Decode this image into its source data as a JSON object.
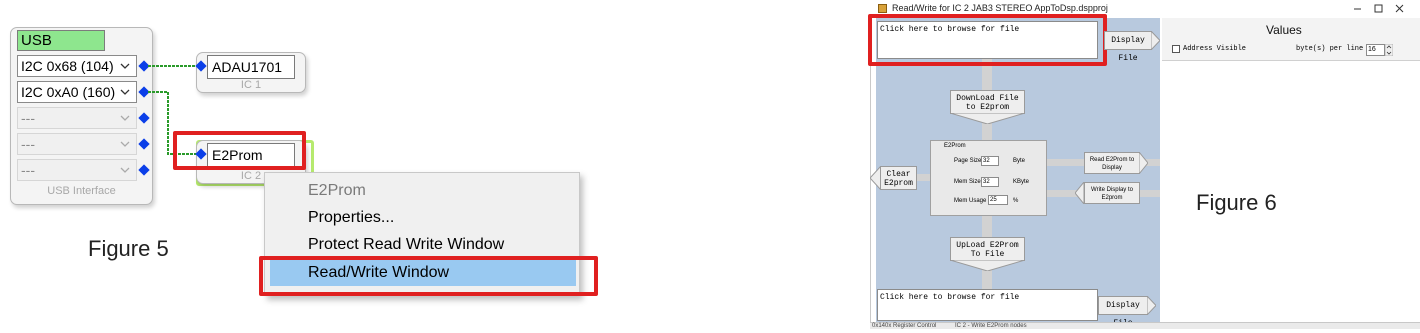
{
  "figure5": {
    "caption": "Figure 5",
    "usb_interface": {
      "title": "USB",
      "footer": "USB Interface",
      "ports": [
        "I2C 0x68 (104)",
        "I2C 0xA0 (160)",
        "---",
        "---",
        "---"
      ]
    },
    "ic1": {
      "field": "ADAU1701",
      "footer": "IC 1"
    },
    "ic2": {
      "field": "E2Prom",
      "footer": "IC 2"
    },
    "context_menu": {
      "header": "E2Prom",
      "items": [
        "Properties...",
        "Protect Read Write Window",
        "Read/Write Window"
      ],
      "selected_index": 2
    },
    "colors": {
      "highlight_border": "#e02020",
      "wire": "#2a9a2a",
      "port_marker": "#0b3fe8",
      "usb_title_fill": "#8ee68e",
      "menu_selection": "#99c9f1"
    }
  },
  "figure6": {
    "caption": "Figure 6",
    "window": {
      "title": "Read/Write for IC 2 JAB3 STEREO AppToDsp.dspproj",
      "controls": [
        "minimize-icon",
        "maximize-icon",
        "close-icon"
      ]
    },
    "top_browse_placeholder": "Click here to browse for file",
    "top_display_button": "Display File",
    "download_button": "DownLoad File to E2prom",
    "clear_button": "Clear E2prom",
    "e2prom_group": {
      "title": "E2Prom",
      "page_size_label": "Page Size",
      "page_size_value": "32",
      "page_size_unit": "Byte",
      "mem_size_label": "Mem Size",
      "mem_size_value": "32",
      "mem_size_unit": "KByte",
      "mem_usage_label": "Mem Usage",
      "mem_usage_value": "25",
      "mem_usage_unit": "%"
    },
    "read_button": "Read E2Prom to Display",
    "write_button": "Write Display to E2prom",
    "upload_button": "UpLoad E2Prom To File",
    "bottom_browse_placeholder": "Click here to browse for file",
    "bottom_display_button": "Display File",
    "values": {
      "title": "Values",
      "address_visible_label": "Address Visible",
      "address_visible_checked": false,
      "bytes_per_line_label": "byte(s) per line",
      "bytes_per_line_value": "16"
    },
    "status_tabs": [
      "0x140x Register Control",
      "IC 2 - Write E2Prom nodes"
    ]
  }
}
